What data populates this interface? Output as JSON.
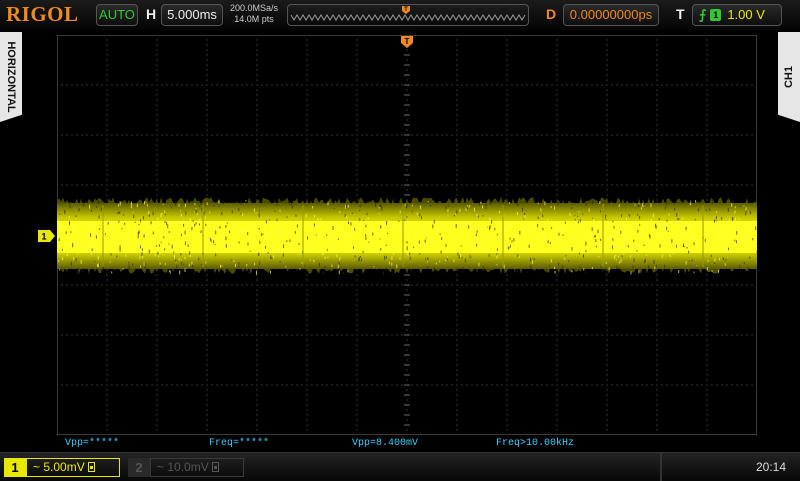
{
  "brand": {
    "logo": "RIGOL",
    "color": "#f08a1c"
  },
  "topbar": {
    "run_state": "AUTO",
    "horizontal_label": "H",
    "timebase": "5.000ms",
    "sample_rate": "200.0MSa/s",
    "memory_depth": "14.0M pts",
    "delay_label": "D",
    "delay_value": "0.00000000ps",
    "trigger_label": "T",
    "trigger_edge_icon": "rising-edge-icon",
    "trigger_source": "1",
    "trigger_level": "1.00 V"
  },
  "side_tabs": {
    "left": "HORIZONTAL",
    "right": "CH1"
  },
  "markers": {
    "trigger_pos": "T",
    "ch1_ground": "1"
  },
  "measurements": [
    {
      "label": "Vpp=*****"
    },
    {
      "label": "Freq=*****"
    },
    {
      "label": "Vpp=8.400mV"
    },
    {
      "label": "Freq>10.00kHz"
    }
  ],
  "bottombar": {
    "ch1_number": "1",
    "ch1_scale": "~ 5.00mV",
    "ch2_number": "2",
    "ch2_scale": "~ 10.0mV",
    "clock": "20:14"
  },
  "colors": {
    "ch1": "#e8e800",
    "measure": "#3ad0ff",
    "trigger": "#f08a1c",
    "run": "#32c832"
  }
}
